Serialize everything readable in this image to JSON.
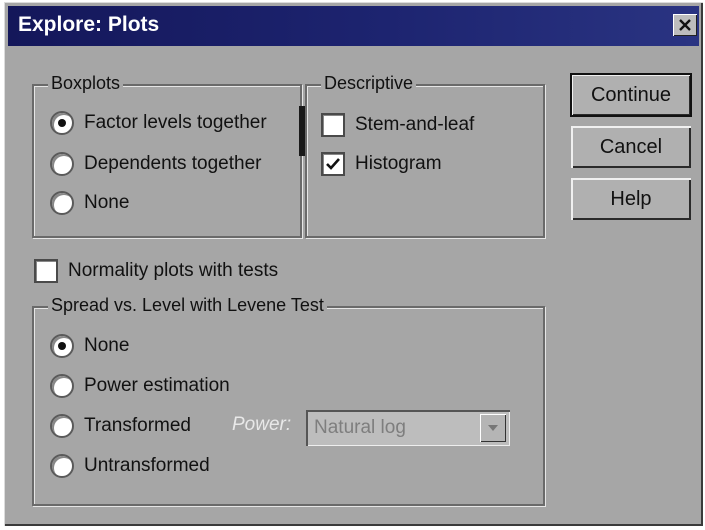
{
  "window": {
    "title": "Explore: Plots"
  },
  "boxplots": {
    "legend": "Boxplots",
    "options": [
      {
        "label": "Factor levels together",
        "checked": true
      },
      {
        "label": "Dependents together",
        "checked": false
      },
      {
        "label": "None",
        "checked": false
      }
    ]
  },
  "descriptive": {
    "legend": "Descriptive",
    "stem_and_leaf": {
      "label": "Stem-and-leaf",
      "checked": false
    },
    "histogram": {
      "label": "Histogram",
      "checked": true
    }
  },
  "normality": {
    "label": "Normality plots with tests",
    "checked": false
  },
  "spread": {
    "legend": "Spread vs. Level with Levene Test",
    "options": [
      {
        "label": "None",
        "checked": true
      },
      {
        "label": "Power estimation",
        "checked": false
      },
      {
        "label": "Transformed",
        "checked": false
      },
      {
        "label": "Untransformed",
        "checked": false
      }
    ],
    "power_label": "Power:",
    "power_value": "Natural log"
  },
  "buttons": {
    "continue": "Continue",
    "cancel": "Cancel",
    "help": "Help"
  },
  "colors": {
    "titlebar": "#1d2470",
    "dialog_bg": "#a6a6a6"
  }
}
